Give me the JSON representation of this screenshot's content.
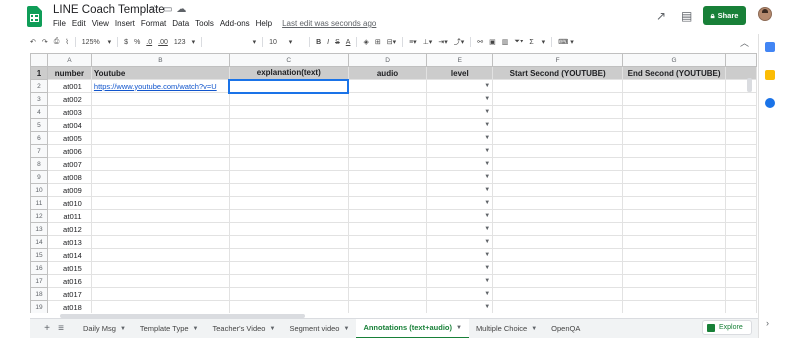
{
  "header": {
    "title": "LINE Coach Template",
    "title_icons": [
      "star-icon",
      "folder-icon",
      "cloud-icon"
    ],
    "menu": [
      "File",
      "Edit",
      "View",
      "Insert",
      "Format",
      "Data",
      "Tools",
      "Add-ons",
      "Help"
    ],
    "last_edit": "Last edit was seconds ago",
    "share_label": "Share",
    "share_color": "#188038"
  },
  "toolbar": {
    "zoom": "125%",
    "currency": "$",
    "percent": "%",
    "decrease_decimals": ".0",
    "increase_decimals": ".00",
    "more_formats": "123",
    "font": "",
    "font_size": "10",
    "bold": "B",
    "italic": "I",
    "strikethrough": "S",
    "text_color": "A",
    "sum": "Σ"
  },
  "grid": {
    "columns": [
      "A",
      "B",
      "C",
      "D",
      "E",
      "F",
      "G"
    ],
    "header_row": [
      "number",
      "Youtube",
      "explanation(text)",
      "audio",
      "level",
      "Start Second (YOUTUBE)",
      "End Second (YOUTUBE)"
    ],
    "row_numbers": [
      "1",
      "2",
      "3",
      "4",
      "5",
      "6",
      "7",
      "8",
      "9",
      "10",
      "11",
      "12",
      "13",
      "14",
      "15",
      "16",
      "17",
      "18",
      "19"
    ],
    "link_cell": "https://www.youtube.com/watch?v=U",
    "ids": [
      "at001",
      "at002",
      "at003",
      "at004",
      "at005",
      "at006",
      "at007",
      "at008",
      "at009",
      "at010",
      "at011",
      "at012",
      "at013",
      "at014",
      "at015",
      "at016",
      "at017",
      "at018"
    ],
    "header_bg": "#cccccc",
    "selection_color": "#1a73e8"
  },
  "tabs": {
    "items": [
      "Daily Msg",
      "Template Type",
      "Teacher's Video",
      "Segment video",
      "Annotations (text+audio)",
      "Multiple Choice",
      "OpenQA"
    ],
    "active_index": 4,
    "explore_label": "Explore"
  }
}
